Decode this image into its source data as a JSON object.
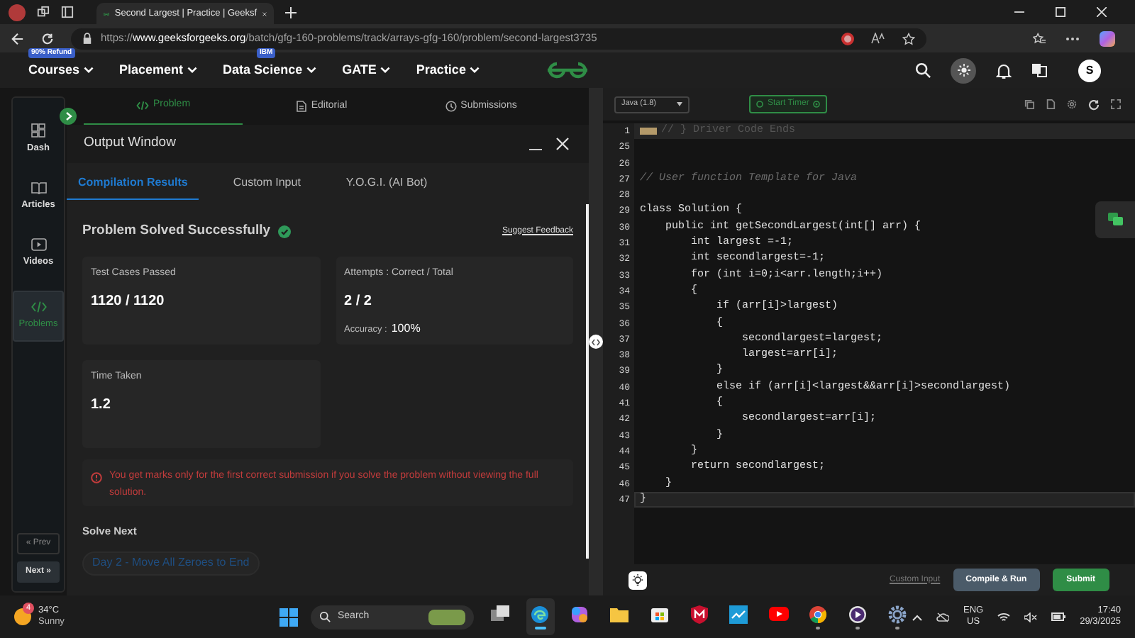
{
  "browser": {
    "tab_title": "Second Largest | Practice | Geeksf",
    "url_scheme": "https://",
    "url_host": "www.geeksforgeeks.org",
    "url_path": "/batch/gfg-160-problems/track/arrays-gfg-160/problem/second-largest3735"
  },
  "nav": {
    "items": [
      {
        "label": "Courses",
        "badge": "90% Refund"
      },
      {
        "label": "Placement"
      },
      {
        "label": "Data Science",
        "badge": "IBM"
      },
      {
        "label": "GATE"
      },
      {
        "label": "Practice"
      }
    ],
    "avatar": "S"
  },
  "sidebar": {
    "items": [
      {
        "label": "Dash",
        "kind": "dash",
        "selected": false
      },
      {
        "label": "Articles",
        "kind": "articles",
        "selected": false
      },
      {
        "label": "Videos",
        "kind": "videos",
        "selected": false
      },
      {
        "label": "Problems",
        "kind": "problems",
        "selected": true
      }
    ],
    "prev": "« Prev",
    "next": "Next »"
  },
  "problem_tabs": [
    {
      "label": "Problem",
      "kind": "code",
      "selected": true
    },
    {
      "label": "Editorial",
      "kind": "doc",
      "selected": false
    },
    {
      "label": "Submissions",
      "kind": "clock",
      "selected": false
    }
  ],
  "output_window": {
    "title": "Output Window",
    "tabs": [
      {
        "label": "Compilation Results",
        "selected": true
      },
      {
        "label": "Custom Input",
        "selected": false
      },
      {
        "label": "Y.O.G.I. (AI Bot)",
        "selected": false
      }
    ],
    "status": "Problem Solved Successfully",
    "feedback_link": "Suggest Feedback",
    "cards": [
      {
        "label": "Test Cases Passed",
        "value": "1120 / 1120"
      },
      {
        "label": "Attempts : Correct / Total",
        "value": "2 / 2",
        "note_label": "Accuracy :",
        "note_value": "100%"
      },
      {
        "label": "Time Taken",
        "value": "1.2"
      }
    ],
    "notice": "You get marks only for the first correct submission if you solve the problem without viewing the full solution.",
    "solve_next": {
      "heading": "Solve Next",
      "items": [
        "Day 2 - Move All Zeroes to End"
      ]
    }
  },
  "editor": {
    "language": "Java (1.8)",
    "timer": "Start Timer",
    "lines": [
      {
        "number": "1",
        "kind": "folded",
        "text": "// } Driver Code Ends",
        "current": false
      },
      {
        "number": "25",
        "kind": "blank",
        "current": false
      },
      {
        "number": "26",
        "kind": "blank",
        "current": false
      },
      {
        "number": "27",
        "kind": "comment",
        "text": "// User function Template for Java",
        "current": false
      },
      {
        "number": "28",
        "kind": "blank",
        "current": false
      },
      {
        "number": "29",
        "kind": "code",
        "text": "class Solution {",
        "current": false
      },
      {
        "number": "30",
        "kind": "code",
        "text": "    public int getSecondLargest(int[] arr) {",
        "current": false
      },
      {
        "number": "31",
        "kind": "code",
        "text": "        int largest =-1;",
        "current": false
      },
      {
        "number": "32",
        "kind": "code",
        "text": "        int secondlargest=-1;",
        "current": false
      },
      {
        "number": "33",
        "kind": "code",
        "text": "        for (int i=0;i<arr.length;i++)",
        "current": false
      },
      {
        "number": "34",
        "kind": "code",
        "text": "        {",
        "current": false
      },
      {
        "number": "35",
        "kind": "code",
        "text": "            if (arr[i]>largest)",
        "current": false
      },
      {
        "number": "36",
        "kind": "code",
        "text": "            {",
        "current": false
      },
      {
        "number": "37",
        "kind": "code",
        "text": "                secondlargest=largest;",
        "current": false
      },
      {
        "number": "38",
        "kind": "code",
        "text": "                largest=arr[i];",
        "current": false
      },
      {
        "number": "39",
        "kind": "code",
        "text": "            }",
        "current": false
      },
      {
        "number": "40",
        "kind": "code",
        "text": "            else if (arr[i]<largest&&arr[i]>secondlargest)",
        "current": false
      },
      {
        "number": "41",
        "kind": "code",
        "text": "            {",
        "current": false
      },
      {
        "number": "42",
        "kind": "code",
        "text": "                secondlargest=arr[i];",
        "current": false
      },
      {
        "number": "43",
        "kind": "code",
        "text": "            }",
        "current": false
      },
      {
        "number": "44",
        "kind": "code",
        "text": "        }",
        "current": false
      },
      {
        "number": "45",
        "kind": "code",
        "text": "        return secondlargest;",
        "current": false
      },
      {
        "number": "46",
        "kind": "code",
        "text": "    }",
        "current": false
      },
      {
        "number": "47",
        "kind": "code",
        "text": "}",
        "current": true
      }
    ],
    "custom_input": "Custom Input",
    "compile_button": "Compile & Run",
    "submit_button": "Submit"
  },
  "taskbar": {
    "weather_badge": "4",
    "temperature": "34°C",
    "condition": "Sunny",
    "search": "Search",
    "apps": [
      {
        "kind": "task-view",
        "active": false,
        "running": false
      },
      {
        "kind": "edge",
        "active": true,
        "running": true
      },
      {
        "kind": "copilot",
        "active": false,
        "running": false
      },
      {
        "kind": "folder",
        "active": false,
        "running": false
      },
      {
        "kind": "store",
        "active": false,
        "running": false
      },
      {
        "kind": "shield",
        "active": false,
        "running": false
      },
      {
        "kind": "chart",
        "active": false,
        "running": false
      },
      {
        "kind": "youtube",
        "active": false,
        "running": false
      },
      {
        "kind": "chrome",
        "active": false,
        "running": true
      },
      {
        "kind": "player",
        "active": false,
        "running": true
      },
      {
        "kind": "settings",
        "active": false,
        "running": true
      }
    ],
    "language": "ENG",
    "region": "US",
    "time": "17:40",
    "date": "29/3/2025"
  }
}
